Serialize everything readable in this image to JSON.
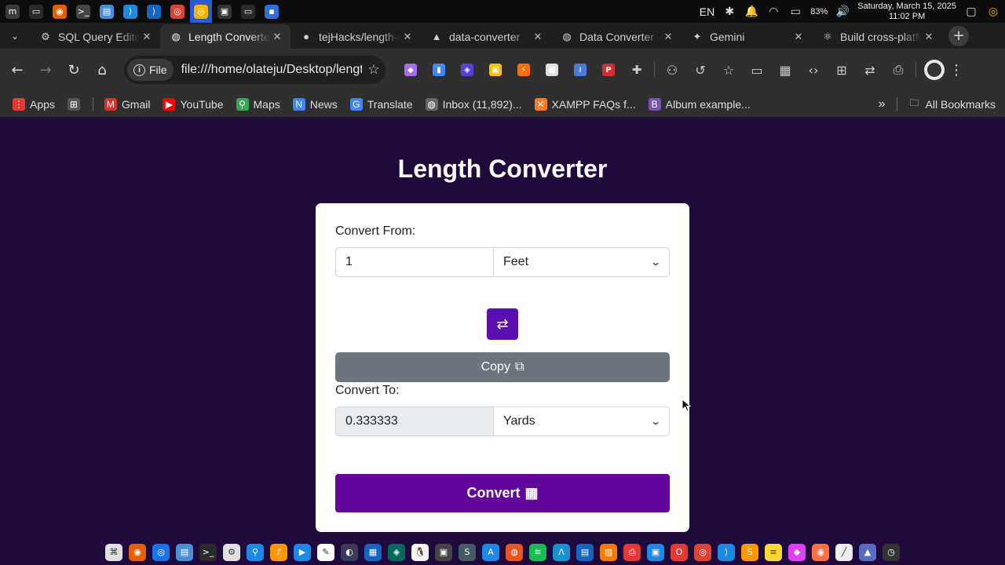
{
  "os_panel": {
    "apps": [
      {
        "icon": "mint-menu-icon",
        "color": "#3b3b3b",
        "glyph": "m"
      },
      {
        "icon": "show-desktop-icon",
        "color": "#2a2a2a",
        "glyph": "▭"
      },
      {
        "icon": "firefox-icon",
        "color": "#e66000",
        "glyph": "◉"
      },
      {
        "icon": "terminal-icon",
        "color": "#444444",
        "glyph": ">_"
      },
      {
        "icon": "files-icon",
        "color": "#4a90d9",
        "glyph": "▤"
      },
      {
        "icon": "vscode-icon",
        "color": "#1e88e5",
        "glyph": "⟩"
      },
      {
        "icon": "vscode-icon",
        "color": "#1565c0",
        "glyph": "⟩"
      },
      {
        "icon": "chrome-icon",
        "color": "#db4437",
        "glyph": "◎"
      },
      {
        "icon": "chrome-icon",
        "color": "#f4b400",
        "glyph": "◎"
      },
      {
        "icon": "terminal-icon",
        "color": "#333333",
        "glyph": "▣"
      },
      {
        "icon": "folder-icon",
        "color": "#2a2a2a",
        "glyph": "▭"
      },
      {
        "icon": "app-icon",
        "color": "#2f6fd6",
        "glyph": "▪"
      }
    ],
    "active_app_index": 8,
    "language": "EN",
    "battery": "83%",
    "clock_date": "Saturday, March 15, 2025",
    "clock_time": "11:02 PM"
  },
  "tabs": [
    {
      "title": "SQL Query Editor",
      "icon": "openai-icon",
      "glyph": "⚙",
      "active": false
    },
    {
      "title": "Length Converter",
      "icon": "globe-icon",
      "glyph": "◍",
      "active": true
    },
    {
      "title": "tejHacks/length-converter",
      "icon": "github-icon",
      "glyph": "●",
      "active": false
    },
    {
      "title": "data-converter",
      "icon": "vercel-icon",
      "glyph": "▲",
      "active": false
    },
    {
      "title": "Data Converter",
      "icon": "globe-icon",
      "glyph": "◍",
      "active": false
    },
    {
      "title": "Gemini",
      "icon": "gemini-icon",
      "glyph": "✦",
      "active": false
    },
    {
      "title": "Build cross-platform",
      "icon": "electron-icon",
      "glyph": "⚛",
      "active": false
    }
  ],
  "toolbar": {
    "file_chip": "File",
    "url": "file:///home/olateju/Desktop/length-converter/index.html",
    "extensions": [
      {
        "icon": "extension-icon",
        "color": "#a46bf5",
        "glyph": "◆"
      },
      {
        "icon": "docs-extension-icon",
        "color": "#4285f4",
        "glyph": "▮"
      },
      {
        "icon": "layers-extension-icon",
        "color": "#5a3fd6",
        "glyph": "◈"
      },
      {
        "icon": "extension-icon",
        "color": "#f4c20d",
        "glyph": "▣"
      },
      {
        "icon": "extension-icon",
        "color": "#ff6d00",
        "glyph": "⚡"
      },
      {
        "icon": "extension-icon",
        "color": "#e0e0e0",
        "glyph": "▦"
      },
      {
        "icon": "chart-extension-icon",
        "color": "#4a7bd8",
        "glyph": "≀"
      },
      {
        "icon": "pdf-extension-icon",
        "color": "#d32f2f",
        "glyph": "P"
      },
      {
        "icon": "puzzle-icon",
        "color": "#555555",
        "glyph": "✚"
      }
    ],
    "tools": [
      {
        "icon": "spy-icon",
        "glyph": "⚇"
      },
      {
        "icon": "history-icon",
        "glyph": "↺"
      },
      {
        "icon": "bookmarks-icon",
        "glyph": "☆"
      },
      {
        "icon": "reading-mode-icon",
        "glyph": "▭"
      },
      {
        "icon": "table-icon",
        "glyph": "▦"
      },
      {
        "icon": "code-icon",
        "glyph": "‹›"
      },
      {
        "icon": "grid-icon",
        "glyph": "⊞"
      },
      {
        "icon": "translate-icon",
        "glyph": "⇄"
      },
      {
        "icon": "print-icon",
        "glyph": "⎙"
      }
    ]
  },
  "bookmarks": [
    {
      "label": "Apps",
      "icon": "apps-icon",
      "color": "#e53935",
      "glyph": "⋮"
    },
    {
      "label": "",
      "icon": "grid-icon",
      "color": "#555555",
      "glyph": "⊞"
    },
    {
      "label": "Gmail",
      "icon": "gmail-icon",
      "color": "#d93025",
      "glyph": "M"
    },
    {
      "label": "YouTube",
      "icon": "youtube-icon",
      "color": "#ff0000",
      "glyph": "▶"
    },
    {
      "label": "Maps",
      "icon": "maps-icon",
      "color": "#34a853",
      "glyph": "⚲"
    },
    {
      "label": "News",
      "icon": "news-icon",
      "color": "#4285f4",
      "glyph": "N"
    },
    {
      "label": "Translate",
      "icon": "translate-icon",
      "color": "#4285f4",
      "glyph": "G"
    },
    {
      "label": "Inbox (11,892)...",
      "icon": "globe-icon",
      "color": "#666666",
      "glyph": "◍"
    },
    {
      "label": "XAMPP FAQs f...",
      "icon": "xampp-icon",
      "color": "#fb7a24",
      "glyph": "✕"
    },
    {
      "label": "Album example...",
      "icon": "bootstrap-icon",
      "color": "#7952b3",
      "glyph": "B"
    }
  ],
  "all_bookmarks": "All Bookmarks",
  "page": {
    "title": "Length Converter",
    "from_label": "Convert From:",
    "from_value": "1",
    "from_unit": "Feet",
    "copy_label": "Copy",
    "to_label": "Convert To:",
    "to_value": "0.333333",
    "to_unit": "Yards",
    "convert_label": "Convert",
    "accent_color": "#62079c",
    "background_color": "#1f0a3d"
  },
  "dock": [
    {
      "icon": "launcher-icon",
      "color": "#e0e0e0",
      "glyph": "⌘"
    },
    {
      "icon": "firefox-icon",
      "color": "#e66000",
      "glyph": "◉"
    },
    {
      "icon": "browser-icon",
      "color": "#1a73e8",
      "glyph": "◎"
    },
    {
      "icon": "files-icon",
      "color": "#4a90d9",
      "glyph": "▤"
    },
    {
      "icon": "terminal-icon",
      "color": "#2b2b2b",
      "glyph": ">_"
    },
    {
      "icon": "settings-icon",
      "color": "#e0e0e0",
      "glyph": "⚙"
    },
    {
      "icon": "search-icon",
      "color": "#1e88e5",
      "glyph": "⚲"
    },
    {
      "icon": "music-icon",
      "color": "#ff9800",
      "glyph": "♪"
    },
    {
      "icon": "video-icon",
      "color": "#1e88e5",
      "glyph": "▶"
    },
    {
      "icon": "editor-icon",
      "color": "#ffffff",
      "glyph": "✎"
    },
    {
      "icon": "eclipse-icon",
      "color": "#3a3a5a",
      "glyph": "◐"
    },
    {
      "icon": "notes-icon",
      "color": "#1565c0",
      "glyph": "▦"
    },
    {
      "icon": "vpn-icon",
      "color": "#00695c",
      "glyph": "◈"
    },
    {
      "icon": "linux-icon",
      "color": "#f4f4f4",
      "glyph": "🐧"
    },
    {
      "icon": "app-icon",
      "color": "#444444",
      "glyph": "▣"
    },
    {
      "icon": "app-icon",
      "color": "#455a64",
      "glyph": "S"
    },
    {
      "icon": "app-store-icon",
      "color": "#1e88e5",
      "glyph": "A"
    },
    {
      "icon": "ubuntu-icon",
      "color": "#e95420",
      "glyph": "◍"
    },
    {
      "icon": "spotify-icon",
      "color": "#1db954",
      "glyph": "≋"
    },
    {
      "icon": "arch-icon",
      "color": "#1793d1",
      "glyph": "Λ"
    },
    {
      "icon": "writer-icon",
      "color": "#1565c0",
      "glyph": "▤"
    },
    {
      "icon": "app-icon",
      "color": "#f57c00",
      "glyph": "▨"
    },
    {
      "icon": "pdf-icon",
      "color": "#e53935",
      "glyph": "⎙"
    },
    {
      "icon": "app-icon",
      "color": "#1e88e5",
      "glyph": "▣"
    },
    {
      "icon": "opera-icon",
      "color": "#e53935",
      "glyph": "O"
    },
    {
      "icon": "chrome-icon",
      "color": "#db4437",
      "glyph": "◎"
    },
    {
      "icon": "vscode-icon",
      "color": "#1e88e5",
      "glyph": "⟩"
    },
    {
      "icon": "sublime-icon",
      "color": "#ff9800",
      "glyph": "S"
    },
    {
      "icon": "notes-icon",
      "color": "#fdd835",
      "glyph": "≡"
    },
    {
      "icon": "gradient-icon",
      "color": "#e040fb",
      "glyph": "◆"
    },
    {
      "icon": "app-icon",
      "color": "#ff7043",
      "glyph": "◉"
    },
    {
      "icon": "pen-icon",
      "color": "#eeeeee",
      "glyph": "╱"
    },
    {
      "icon": "image-icon",
      "color": "#5c6bc0",
      "glyph": "▲"
    },
    {
      "icon": "clock-icon",
      "color": "#333333",
      "glyph": "◷"
    }
  ]
}
